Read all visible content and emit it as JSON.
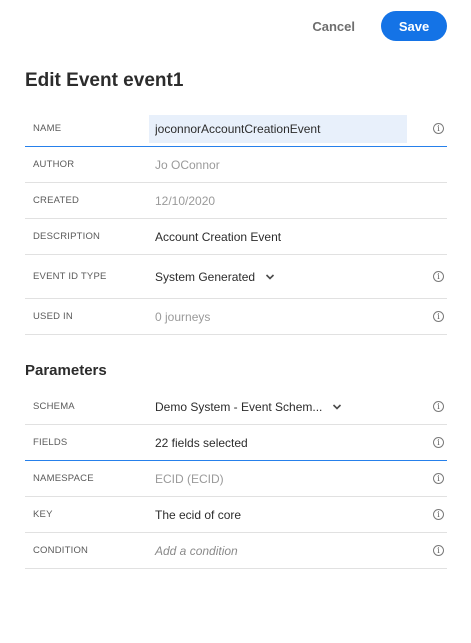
{
  "actions": {
    "cancel_label": "Cancel",
    "save_label": "Save"
  },
  "page": {
    "title": "Edit Event event1",
    "parameters_title": "Parameters"
  },
  "event": {
    "name_label": "NAME",
    "name_value": "joconnorAccountCreationEvent",
    "author_label": "AUTHOR",
    "author_value": "Jo OConnor",
    "created_label": "CREATED",
    "created_value": "12/10/2020",
    "description_label": "DESCRIPTION",
    "description_value": "Account Creation Event",
    "event_id_type_label": "EVENT ID TYPE",
    "event_id_type_value": "System Generated",
    "used_in_label": "USED IN",
    "used_in_value": "0 journeys"
  },
  "parameters": {
    "schema_label": "SCHEMA",
    "schema_value": "Demo System - Event Schem...",
    "fields_label": "FIELDS",
    "fields_value": "22 fields selected",
    "namespace_label": "NAMESPACE",
    "namespace_value": "ECID (ECID)",
    "key_label": "KEY",
    "key_value": "The ecid of core",
    "condition_label": "CONDITION",
    "condition_placeholder": "Add a condition"
  },
  "icons": {
    "info": "info-icon",
    "chevron": "chevron-down-icon"
  },
  "colors": {
    "accent": "#1473e6",
    "input_bg": "#e8f0fb",
    "focus_line": "#2680eb"
  }
}
